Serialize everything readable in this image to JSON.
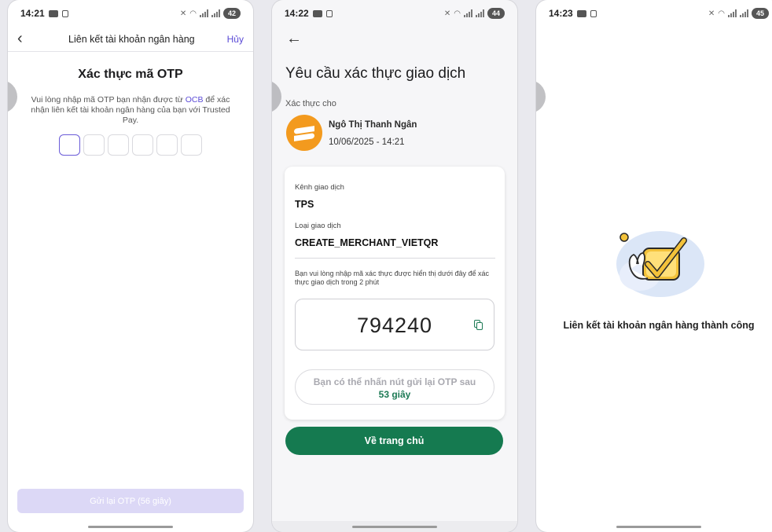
{
  "screens": [
    {
      "status": {
        "time": "14:21",
        "battery": "42"
      },
      "header": {
        "title": "Liên kết tài khoản ngân hàng",
        "cancel": "Hủy"
      },
      "heading": "Xác thực mã OTP",
      "desc_before": "Vui lòng nhập mã OTP bạn nhận được từ ",
      "bank": "OCB",
      "desc_after": " để xác nhận liên kết tài khoản ngân hàng của bạn với Trusted Pay.",
      "resend_button": "Gửi lại OTP (56 giây)"
    },
    {
      "status": {
        "time": "14:22",
        "battery": "44"
      },
      "title": "Yêu cầu xác thực giao dịch",
      "verify_for": "Xác thực cho",
      "name": "Ngô Thị Thanh Ngân",
      "datetime": "10/06/2025 - 14:21",
      "channel_label": "Kênh giao dịch",
      "channel_value": "TPS",
      "type_label": "Loại giao dịch",
      "type_value": "CREATE_MERCHANT_VIETQR",
      "note": "Bạn vui lòng nhập mã xác thực được hiển thị dưới đây để xác thực giao dịch trong 2 phút",
      "code": "794240",
      "timer_text": "Bạn có thể nhấn nút gửi lại OTP sau",
      "timer_seconds": "53 giây",
      "home_button": "Về trang chủ"
    },
    {
      "status": {
        "time": "14:23",
        "battery": "45"
      },
      "success": "Liên kết tài khoản ngân hàng thành công"
    }
  ],
  "colors": {
    "purple": "#5b4bd6",
    "green": "#157a50",
    "orange": "#f39a1e"
  },
  "icons": [
    "back-chevron-icon",
    "back-arrow-icon",
    "copy-icon",
    "success-check-icon"
  ]
}
